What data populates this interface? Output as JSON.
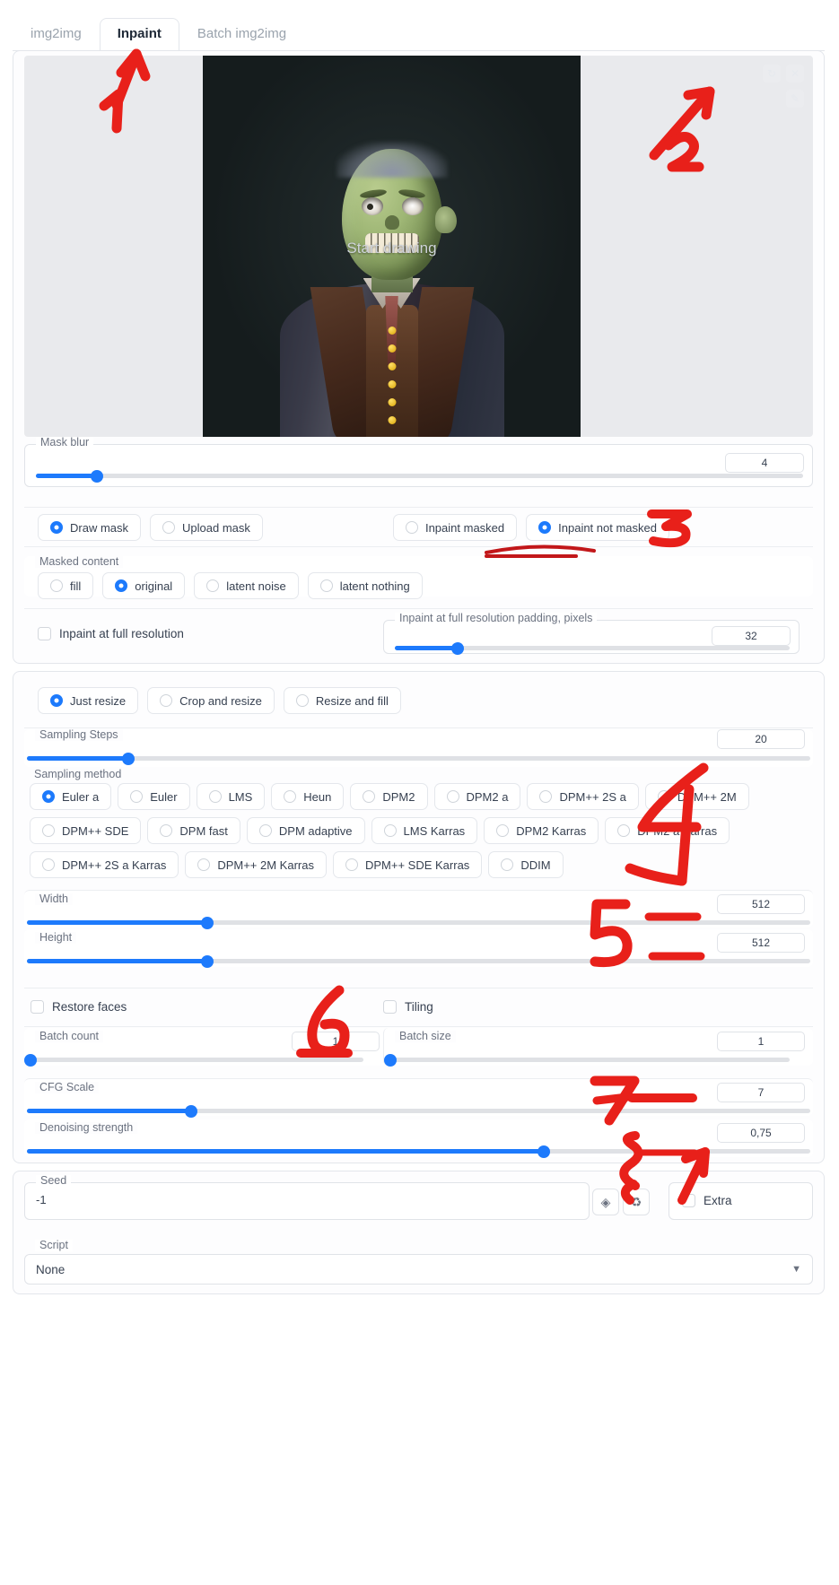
{
  "tabs": [
    {
      "label": "img2img",
      "active": false
    },
    {
      "label": "Inpaint",
      "active": true
    },
    {
      "label": "Batch img2img",
      "active": false
    }
  ],
  "canvas": {
    "placeholder": "Start drawing",
    "undo_icon": "undo-icon",
    "clear_icon": "close-icon",
    "brush_icon": "brush-icon"
  },
  "mask_blur": {
    "label": "Mask blur",
    "value": "4",
    "fill_percent": 8
  },
  "mask_mode": {
    "options": [
      {
        "label": "Draw mask",
        "selected": true
      },
      {
        "label": "Upload mask",
        "selected": false
      }
    ]
  },
  "inpaint_area_mode": {
    "options": [
      {
        "label": "Inpaint masked",
        "selected": false
      },
      {
        "label": "Inpaint not masked",
        "selected": true
      }
    ]
  },
  "masked_content": {
    "label": "Masked content",
    "options": [
      {
        "label": "fill",
        "selected": false
      },
      {
        "label": "original",
        "selected": true
      },
      {
        "label": "latent noise",
        "selected": false
      },
      {
        "label": "latent nothing",
        "selected": false
      }
    ]
  },
  "full_resolution": {
    "checkbox_label": "Inpaint at full resolution",
    "checked": false,
    "padding_label": "Inpaint at full resolution padding, pixels",
    "padding_value": "32",
    "padding_fill_percent": 16
  },
  "resize_mode": {
    "options": [
      {
        "label": "Just resize",
        "selected": true
      },
      {
        "label": "Crop and resize",
        "selected": false
      },
      {
        "label": "Resize and fill",
        "selected": false
      }
    ]
  },
  "sampling_steps": {
    "label": "Sampling Steps",
    "value": "20",
    "fill_percent": 13
  },
  "sampling_method": {
    "label": "Sampling method",
    "rows": [
      [
        {
          "label": "Euler a",
          "selected": true
        },
        {
          "label": "Euler",
          "selected": false
        },
        {
          "label": "LMS",
          "selected": false
        },
        {
          "label": "Heun",
          "selected": false
        },
        {
          "label": "DPM2",
          "selected": false
        },
        {
          "label": "DPM2 a",
          "selected": false
        },
        {
          "label": "DPM++ 2S a",
          "selected": false
        },
        {
          "label": "DPM++ 2M",
          "selected": false
        }
      ],
      [
        {
          "label": "DPM++ SDE",
          "selected": false
        },
        {
          "label": "DPM fast",
          "selected": false
        },
        {
          "label": "DPM adaptive",
          "selected": false
        },
        {
          "label": "LMS Karras",
          "selected": false
        },
        {
          "label": "DPM2 Karras",
          "selected": false
        },
        {
          "label": "DPM2 a Karras",
          "selected": false
        }
      ],
      [
        {
          "label": "DPM++ 2S a Karras",
          "selected": false
        },
        {
          "label": "DPM++ 2M Karras",
          "selected": false
        },
        {
          "label": "DPM++ SDE Karras",
          "selected": false
        },
        {
          "label": "DDIM",
          "selected": false
        }
      ]
    ]
  },
  "width": {
    "label": "Width",
    "value": "512",
    "fill_percent": 23
  },
  "height": {
    "label": "Height",
    "value": "512",
    "fill_percent": 23
  },
  "restore_faces": {
    "label": "Restore faces",
    "checked": false
  },
  "tiling": {
    "label": "Tiling",
    "checked": false
  },
  "batch_count": {
    "label": "Batch count",
    "value": "1",
    "fill_percent": 1
  },
  "batch_size": {
    "label": "Batch size",
    "value": "1",
    "fill_percent": 1
  },
  "cfg_scale": {
    "label": "CFG Scale",
    "value": "7",
    "fill_percent": 21
  },
  "denoising_strength": {
    "label": "Denoising strength",
    "value": "0,75",
    "fill_percent": 75
  },
  "seed": {
    "label": "Seed",
    "value": "-1",
    "dice_icon": "dice-icon",
    "recycle_icon": "recycle-icon",
    "extra_label": "Extra",
    "extra_checked": false
  },
  "script": {
    "label": "Script",
    "value": "None",
    "chevron_icon": "chevron-down-icon"
  },
  "annotations": [
    {
      "number": "1",
      "target": "inpaint-tab"
    },
    {
      "number": "2",
      "target": "brush-tool"
    },
    {
      "number": "3",
      "target": "inpaint-not-masked"
    },
    {
      "number": "4",
      "target": "sampling-method"
    },
    {
      "number": "5",
      "target": "width-height"
    },
    {
      "number": "6",
      "target": "batch-count"
    },
    {
      "number": "7",
      "target": "cfg-scale"
    },
    {
      "number": "8",
      "target": "denoising-strength"
    }
  ],
  "colors": {
    "accent": "#1d7afc",
    "annotation": "#e8201a",
    "panel_border": "#e3e6eb"
  }
}
